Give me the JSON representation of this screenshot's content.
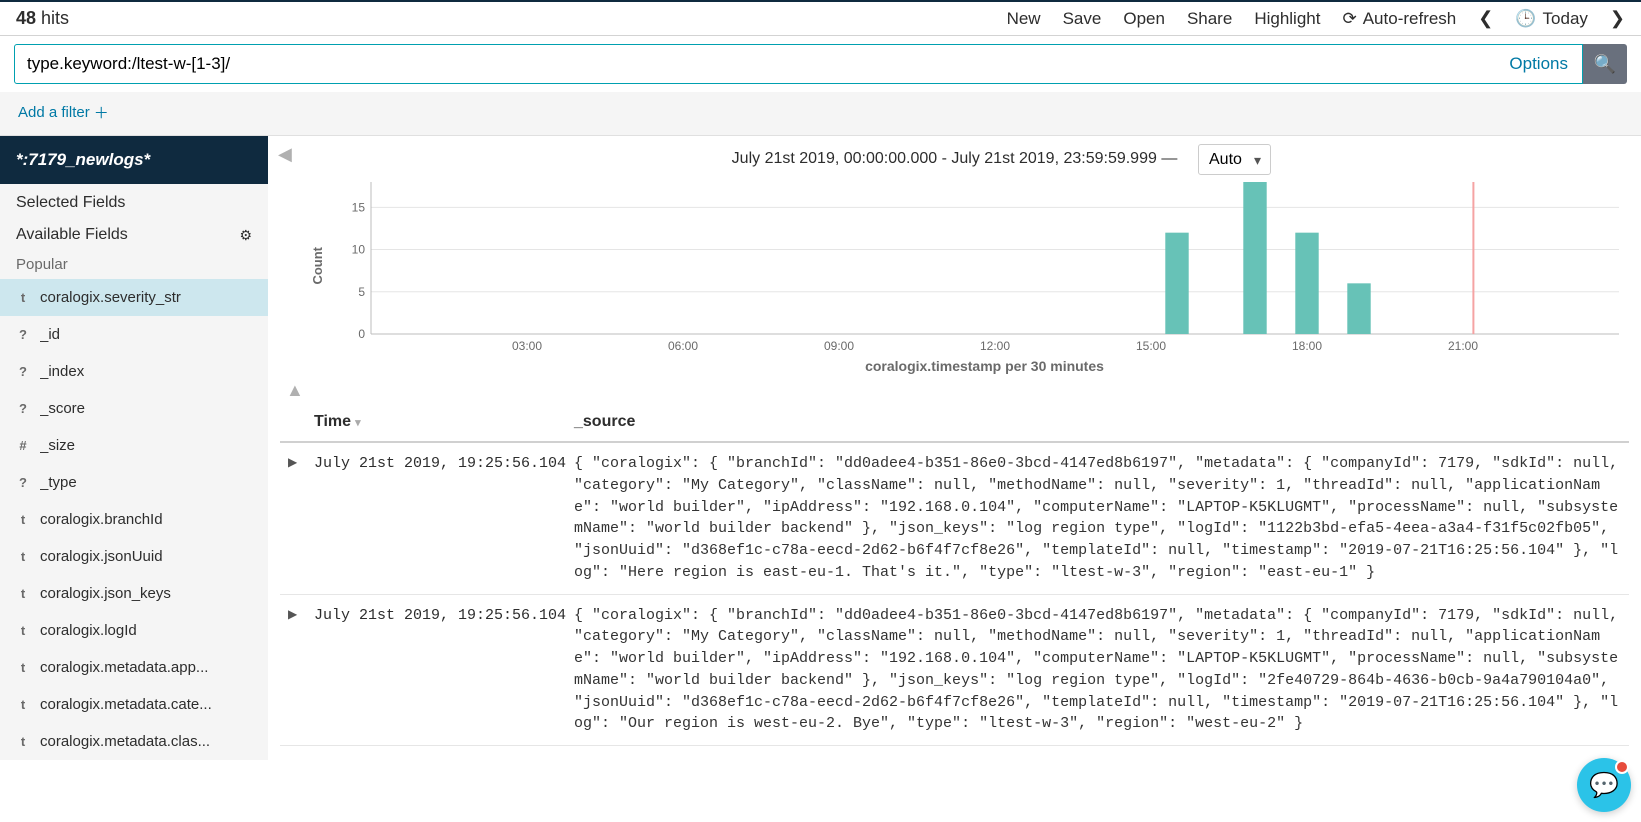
{
  "hits": {
    "count": "48",
    "label": "hits"
  },
  "toolbar": {
    "new": "New",
    "save": "Save",
    "open": "Open",
    "share": "Share",
    "highlight": "Highlight",
    "auto_refresh": "Auto-refresh",
    "today": "Today"
  },
  "search": {
    "value": "type.keyword:/ltest-w-[1-3]/",
    "options": "Options"
  },
  "filter": {
    "add": "Add a filter"
  },
  "sidebar": {
    "index_pattern": "*:7179_newlogs*",
    "selected_fields_label": "Selected Fields",
    "available_fields_label": "Available Fields",
    "popular_label": "Popular",
    "popular": [
      {
        "type": "t",
        "name": "coralogix.severity_str"
      }
    ],
    "fields": [
      {
        "type": "?",
        "name": "_id"
      },
      {
        "type": "?",
        "name": "_index"
      },
      {
        "type": "?",
        "name": "_score"
      },
      {
        "type": "#",
        "name": "_size"
      },
      {
        "type": "?",
        "name": "_type"
      },
      {
        "type": "t",
        "name": "coralogix.branchId"
      },
      {
        "type": "t",
        "name": "coralogix.jsonUuid"
      },
      {
        "type": "t",
        "name": "coralogix.json_keys"
      },
      {
        "type": "t",
        "name": "coralogix.logId"
      },
      {
        "type": "t",
        "name": "coralogix.metadata.app..."
      },
      {
        "type": "t",
        "name": "coralogix.metadata.cate..."
      },
      {
        "type": "t",
        "name": "coralogix.metadata.clas..."
      }
    ]
  },
  "chart": {
    "title": "July 21st 2019, 00:00:00.000 - July 21st 2019, 23:59:59.999 —",
    "interval": "Auto",
    "ylabel": "Count",
    "xlabel": "coralogix.timestamp per 30 minutes"
  },
  "chart_data": {
    "type": "bar",
    "ylabel": "Count",
    "xlabel": "coralogix.timestamp per 30 minutes",
    "ylim": [
      0,
      18
    ],
    "yticks": [
      0,
      5,
      10,
      15
    ],
    "xticks": [
      "03:00",
      "06:00",
      "09:00",
      "12:00",
      "15:00",
      "18:00",
      "21:00"
    ],
    "x_range_hours": [
      0,
      24
    ],
    "bars": [
      {
        "hour": 15.5,
        "value": 12
      },
      {
        "hour": 17.0,
        "value": 18
      },
      {
        "hour": 18.0,
        "value": 12
      },
      {
        "hour": 19.0,
        "value": 6
      }
    ],
    "now_marker_hour": 21.2
  },
  "table": {
    "col_time": "Time",
    "col_source": "_source",
    "rows": [
      {
        "time": "July 21st 2019, 19:25:56.104",
        "source": "{ \"coralogix\": { \"branchId\": \"dd0adee4-b351-86e0-3bcd-4147ed8b6197\", \"metadata\": { \"companyId\": 7179, \"sdkId\": null, \"category\": \"My Category\", \"className\": null, \"methodName\": null, \"severity\": 1, \"threadId\": null, \"applicationName\": \"world builder\", \"ipAddress\": \"192.168.0.104\", \"computerName\": \"LAPTOP-K5KLUGMT\", \"processName\": null, \"subsystemName\": \"world builder backend\" }, \"json_keys\": \"log region type\", \"logId\": \"1122b3bd-efa5-4eea-a3a4-f31f5c02fb05\", \"jsonUuid\": \"d368ef1c-c78a-eecd-2d62-b6f4f7cf8e26\", \"templateId\": null, \"timestamp\": \"2019-07-21T16:25:56.104\" }, \"log\": \"Here region is east-eu-1. That's it.\", \"type\": \"ltest-w-3\", \"region\": \"east-eu-1\" }"
      },
      {
        "time": "July 21st 2019, 19:25:56.104",
        "source": "{ \"coralogix\": { \"branchId\": \"dd0adee4-b351-86e0-3bcd-4147ed8b6197\", \"metadata\": { \"companyId\": 7179, \"sdkId\": null, \"category\": \"My Category\", \"className\": null, \"methodName\": null, \"severity\": 1, \"threadId\": null, \"applicationName\": \"world builder\", \"ipAddress\": \"192.168.0.104\", \"computerName\": \"LAPTOP-K5KLUGMT\", \"processName\": null, \"subsystemName\": \"world builder backend\" }, \"json_keys\": \"log region type\", \"logId\": \"2fe40729-864b-4636-b0cb-9a4a790104a0\", \"jsonUuid\": \"d368ef1c-c78a-eecd-2d62-b6f4f7cf8e26\", \"templateId\": null, \"timestamp\": \"2019-07-21T16:25:56.104\" }, \"log\": \"Our region is west-eu-2. Bye\", \"type\": \"ltest-w-3\", \"region\": \"west-eu-2\" }"
      }
    ]
  }
}
